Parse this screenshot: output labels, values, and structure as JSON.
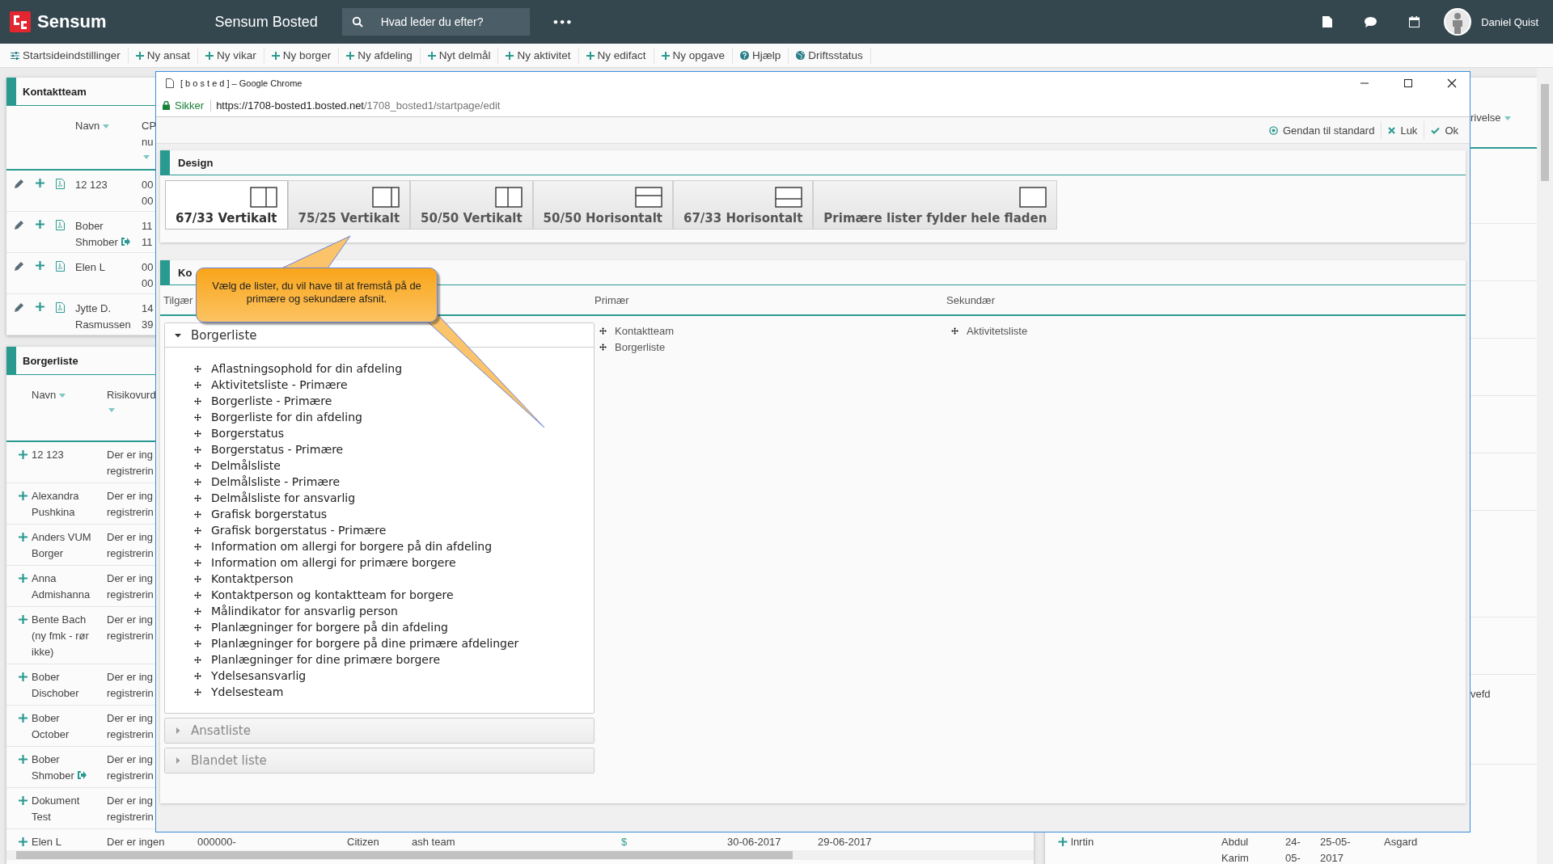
{
  "topbar": {
    "logo": "Sensum",
    "app_title": "Sensum Bosted",
    "search": {
      "placeholder": "Hvad leder du efter?"
    },
    "more": "•••",
    "user": "Daniel Quist"
  },
  "toolbar": [
    {
      "label": "Startsideindstillinger",
      "kind": "settings"
    },
    {
      "label": "Ny ansat",
      "kind": "add"
    },
    {
      "label": "Ny vikar",
      "kind": "add"
    },
    {
      "label": "Ny borger",
      "kind": "add"
    },
    {
      "label": "Ny afdeling",
      "kind": "add"
    },
    {
      "label": "Nyt delmål",
      "kind": "add"
    },
    {
      "label": "Ny aktivitet",
      "kind": "add"
    },
    {
      "label": "Ny edifact",
      "kind": "add"
    },
    {
      "label": "Ny opgave",
      "kind": "add"
    },
    {
      "label": "Hjælp",
      "kind": "help"
    },
    {
      "label": "Driftsstatus",
      "kind": "status"
    }
  ],
  "contact_panel": {
    "title": "Kontaktteam",
    "columns": [
      "Navn",
      "CP\nnu"
    ],
    "rows": [
      {
        "moved": false,
        "cells": [
          "12 123",
          "00\n00"
        ]
      },
      {
        "moved": true,
        "cells": [
          "Bober\nShmober",
          "11\n11"
        ]
      },
      {
        "moved": false,
        "cells": [
          "Elen L",
          "00\n00"
        ]
      },
      {
        "moved": false,
        "cells": [
          "Jytte D.\nRasmussen",
          "14\n39"
        ]
      }
    ]
  },
  "citizen_panel": {
    "title": "Borgerliste",
    "columns": [
      "Navn",
      "Risikovurd"
    ],
    "rows": [
      {
        "moved": false,
        "cells": [
          "12 123",
          "Der er ing\nregistrerin"
        ]
      },
      {
        "moved": false,
        "cells": [
          "Alexandra\nPushkina",
          "Der er ing\nregistrerin"
        ]
      },
      {
        "moved": false,
        "cells": [
          "Anders VUM\nBorger",
          "Der er ing\nregistrerin"
        ]
      },
      {
        "moved": false,
        "cells": [
          "Anna\nAdmishanna",
          "Der er ing\nregistrerin"
        ]
      },
      {
        "moved": false,
        "cells": [
          "Bente Bach\n(ny fmk - rør\nikke)",
          "Der er ing\nregistrerin"
        ]
      },
      {
        "moved": false,
        "cells": [
          "Bober\nDischober",
          "Der er ing\nregistrerin"
        ]
      },
      {
        "moved": false,
        "cells": [
          "Bober\nOctober",
          "Der er ing\nregistrerin"
        ]
      },
      {
        "moved": true,
        "cells": [
          "Bober\nShmober",
          "Der er ing\nregistrerin"
        ]
      },
      {
        "moved": false,
        "cells": [
          "Dokument\nTest",
          "Der er ing\nregistrerin"
        ]
      },
      {
        "moved": false,
        "cells": [
          "Elen L",
          "Der er ingen",
          "000000-",
          "Citizen",
          "ash team",
          "$",
          "30-06-2017",
          "29-06-2017"
        ]
      }
    ]
  },
  "right_panel": {
    "header": "rivelse",
    "rows": [
      {
        "cells": [
          "vefd"
        ]
      },
      {
        "cells": [
          "lnrtin",
          "Abdul\nKarim",
          "24-\n05-",
          "25-05-\n2017",
          "Asgard"
        ]
      }
    ]
  },
  "popup": {
    "title": "[ b o s t e d ] – Google Chrome",
    "secure_label": "Sikker",
    "url_host": "https://1708-bosted1.bosted.net",
    "url_path": "/1708_bosted1/startpage/edit",
    "actions": [
      {
        "label": "Gendan til standard",
        "kind": "reset"
      },
      {
        "label": "Luk",
        "kind": "close"
      },
      {
        "label": "Ok",
        "kind": "ok"
      }
    ],
    "design": {
      "title": "Design",
      "options": [
        {
          "label": "67/33 Vertikalt",
          "kind": "v67",
          "selected": true
        },
        {
          "label": "75/25 Vertikalt",
          "kind": "v75",
          "selected": false
        },
        {
          "label": "50/50 Vertikalt",
          "kind": "v50",
          "selected": false
        },
        {
          "label": "50/50 Horisontalt",
          "kind": "h50",
          "selected": false
        },
        {
          "label": "67/33 Horisontalt",
          "kind": "h67",
          "selected": false
        },
        {
          "label": "Primære lister fylder hele fladen",
          "kind": "full",
          "selected": false
        }
      ]
    },
    "columns_panel": {
      "title": "Ko",
      "headers": [
        "Tilgær",
        "Primær",
        "Sekundær"
      ],
      "groups": [
        {
          "title": "Borgerliste",
          "expanded": true,
          "items": [
            "Aflastningsophold for din afdeling",
            "Aktivitetsliste - Primære",
            "Borgerliste - Primære",
            "Borgerliste for din afdeling",
            "Borgerstatus",
            "Borgerstatus - Primære",
            "Delmålsliste",
            "Delmålsliste - Primære",
            "Delmålsliste for ansvarlig",
            "Grafisk borgerstatus",
            "Grafisk borgerstatus - Primære",
            "Information om allergi for borgere på din afdeling",
            "Information om allergi for primære borgere",
            "Kontaktperson",
            "Kontaktperson og kontaktteam for borgere",
            "Målindikator for ansvarlig person",
            "Planlægninger for borgere på din afdeling",
            "Planlægninger for borgere på dine primære afdelinger",
            "Planlægninger for dine primære borgere",
            "Ydelsesansvarlig",
            "Ydelsesteam"
          ]
        },
        {
          "title": "Ansatliste",
          "expanded": false
        },
        {
          "title": "Blandet liste",
          "expanded": false
        }
      ],
      "primary": [
        "Kontaktteam",
        "Borgerliste"
      ],
      "secondary": [
        "Aktivitetsliste"
      ]
    },
    "tooltip": "Vælg de lister, du vil have til at fremstå på de primære og sekundære afsnit."
  }
}
